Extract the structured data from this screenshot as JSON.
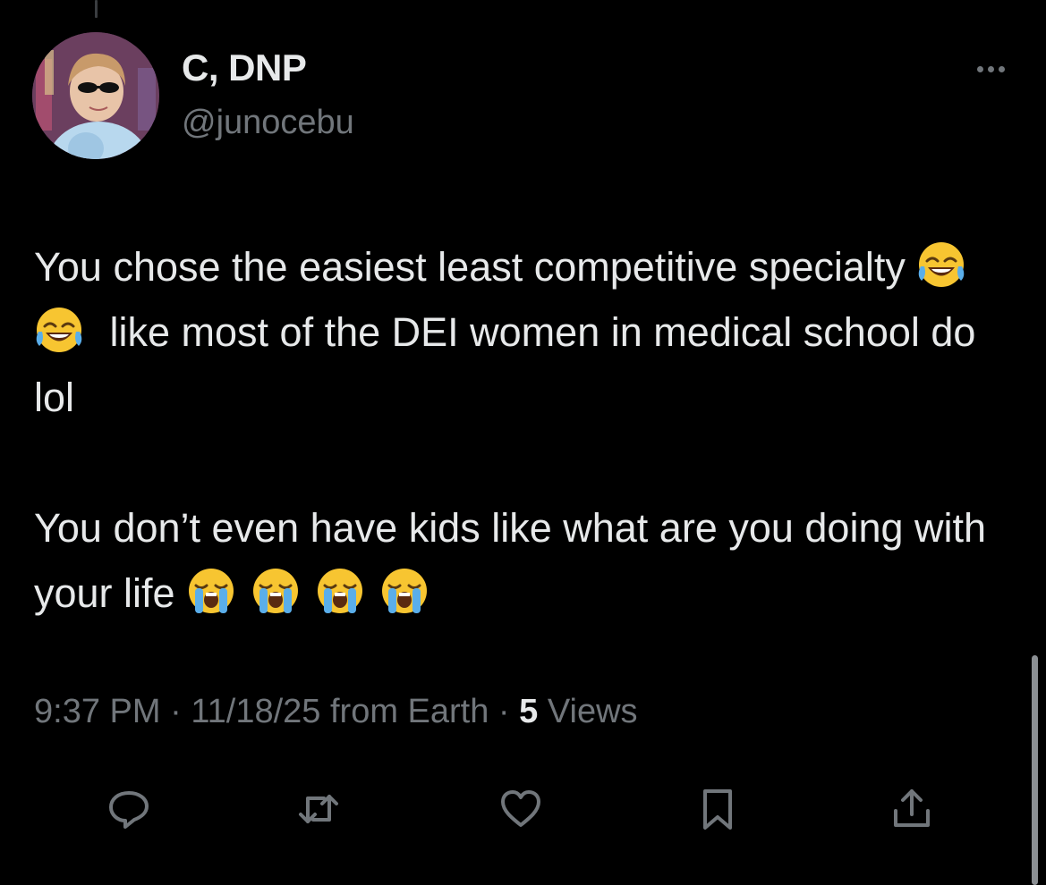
{
  "tweet": {
    "author": {
      "display_name": "C, DNP",
      "handle": "@junocebu",
      "avatar_icon": "profile-photo"
    },
    "text": {
      "line_1_part_1": "You chose the easiest least competitive specialty ",
      "line_1_emojis": [
        "face-with-tears-of-joy",
        "face-with-tears-of-joy"
      ],
      "line_1_part_2": " like most of the DEI women in medical school do lol",
      "line_2_part_1": "You don’t even have kids like what are you doing with your life ",
      "line_2_emojis": [
        "loudly-crying-face",
        "loudly-crying-face",
        "loudly-crying-face",
        "loudly-crying-face"
      ]
    },
    "meta": {
      "time": "9:37 PM",
      "separator": " · ",
      "date": "11/18/25",
      "source": " from Earth",
      "separator_2": " · ",
      "views_count": "5",
      "views_label": " Views"
    },
    "actions": {
      "reply_icon": "reply-icon",
      "retweet_icon": "retweet-icon",
      "like_icon": "heart-icon",
      "bookmark_icon": "bookmark-icon",
      "share_icon": "share-icon"
    }
  },
  "colors": {
    "background": "#000000",
    "primary_text": "#e7e9ea",
    "secondary_text": "#71767b"
  }
}
